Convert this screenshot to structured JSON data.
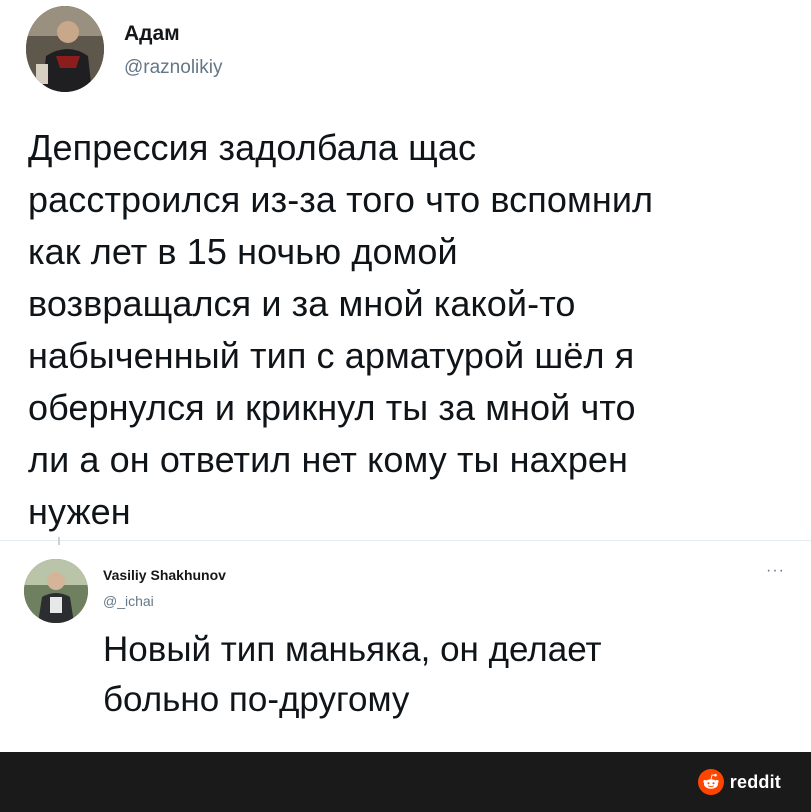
{
  "main_tweet": {
    "author_name": "Адам",
    "author_handle": "@raznolikiy",
    "avatar_icon": "user-avatar-icon",
    "text": "Депрессия задолбала щас\nрасстроился из-за того что вспомнил\nкак лет в 15 ночью домой\nвозвращался и за мной какой-то\nнабыченный тип с арматурой шёл я\nобернулся и крикнул ты за мной что\nли а он ответил нет кому ты нахрен\nнужен"
  },
  "reply": {
    "author_name": "Vasiliy Shakhunov",
    "author_handle": "@_ichai",
    "avatar_icon": "user-avatar-icon",
    "more_label": "···",
    "text": "Новый тип маньяка, он делает\nбольно по-другому"
  },
  "footer": {
    "brand_label": "reddit",
    "brand_icon": "reddit-alien-icon"
  },
  "colors": {
    "footer_bg": "#1a1a1b",
    "reddit_orange": "#ff4500",
    "handle_gray": "#657786",
    "separator": "#e6ecf0"
  }
}
